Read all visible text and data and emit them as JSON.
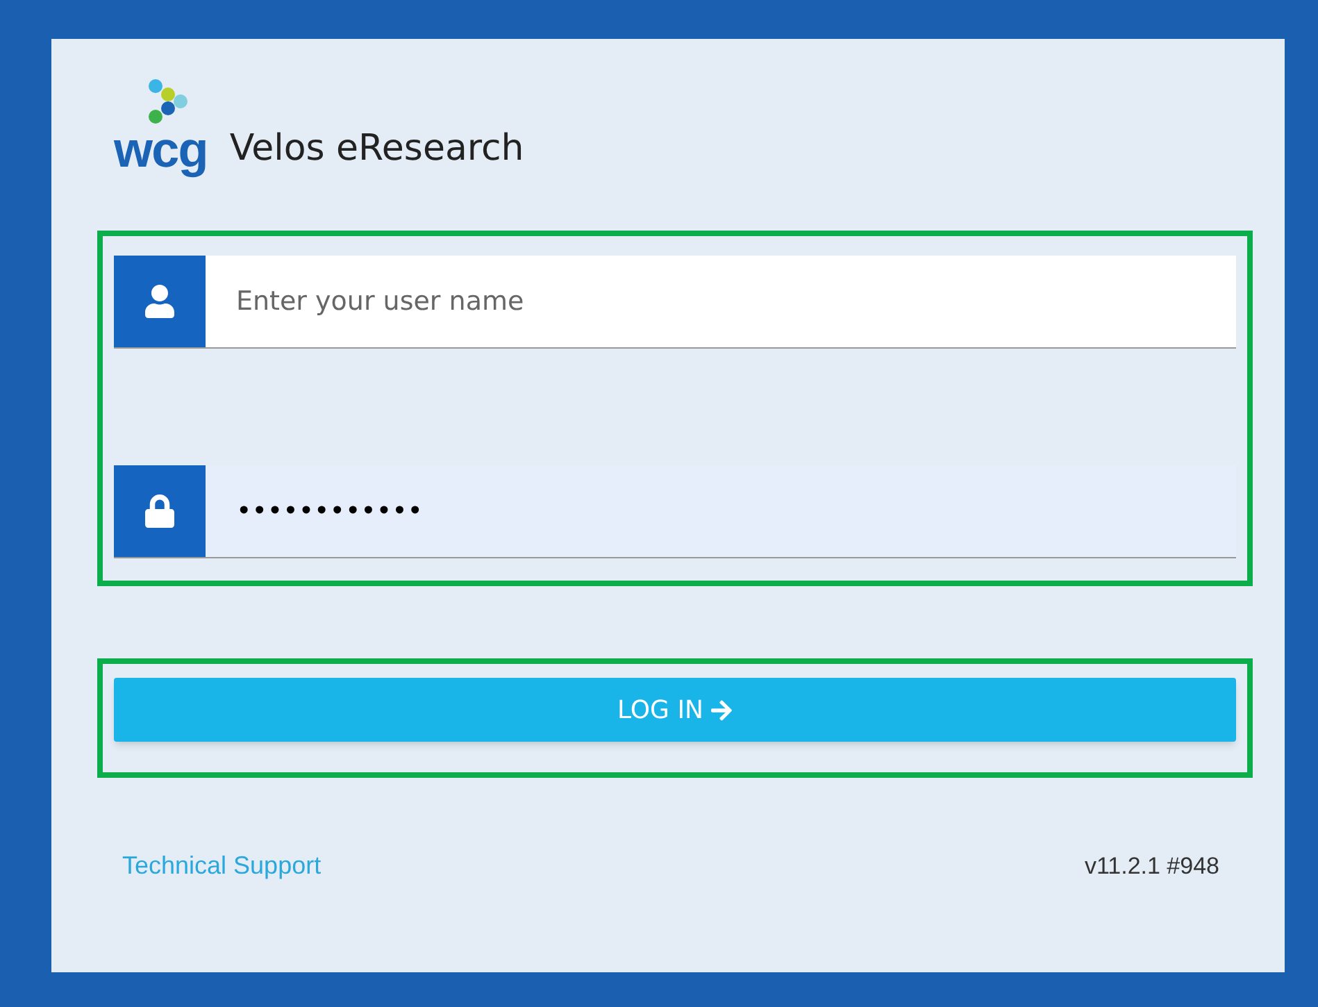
{
  "brand": {
    "logo_text": "wcg",
    "product": "Velos eResearch"
  },
  "fields": [
    {
      "kind": "user",
      "placeholder": "Enter your user name"
    },
    {
      "kind": "password",
      "value": "••••••••••••"
    }
  ],
  "login_button": {
    "label": "LOG IN"
  },
  "footer": {
    "link": "Technical Support",
    "version": "v11.2.1 #948"
  }
}
